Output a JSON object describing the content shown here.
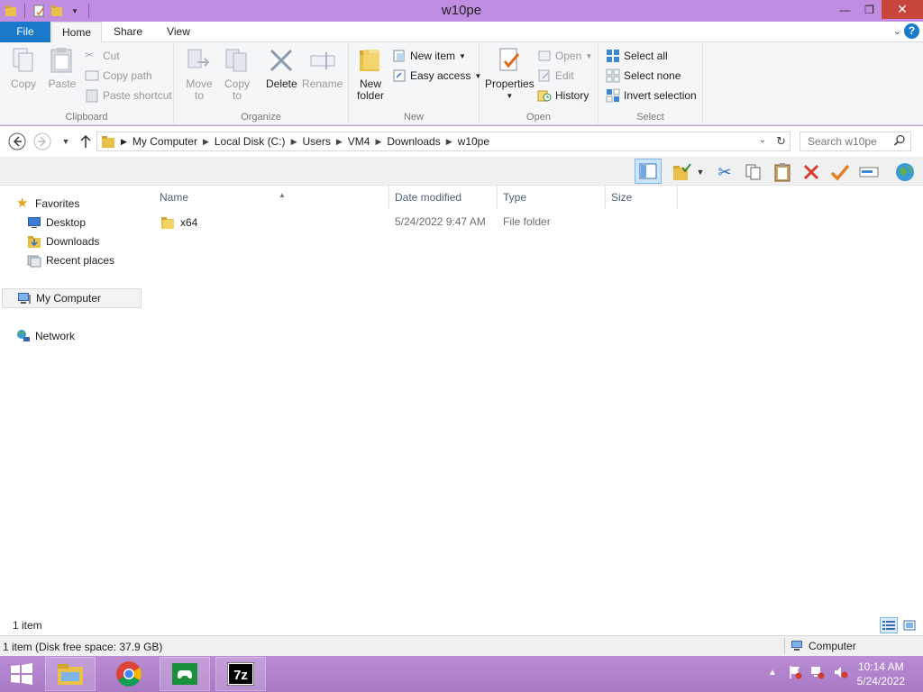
{
  "window": {
    "title": "w10pe"
  },
  "tabs": {
    "file": "File",
    "home": "Home",
    "share": "Share",
    "view": "View"
  },
  "ribbon": {
    "clipboard": {
      "label": "Clipboard",
      "copy": "Copy",
      "paste": "Paste",
      "cut": "Cut",
      "copy_path": "Copy path",
      "paste_shortcut": "Paste shortcut"
    },
    "organize": {
      "label": "Organize",
      "move_to_1": "Move",
      "move_to_2": "to",
      "copy_to_1": "Copy",
      "copy_to_2": "to",
      "delete": "Delete",
      "rename": "Rename"
    },
    "new": {
      "label": "New",
      "new_folder_1": "New",
      "new_folder_2": "folder",
      "new_item": "New item",
      "easy_access": "Easy access"
    },
    "open": {
      "label": "Open",
      "properties": "Properties",
      "open": "Open",
      "edit": "Edit",
      "history": "History"
    },
    "select": {
      "label": "Select",
      "select_all": "Select all",
      "select_none": "Select none",
      "invert_selection": "Invert selection"
    }
  },
  "address": {
    "breadcrumbs": [
      "My Computer",
      "Local Disk (C:)",
      "Users",
      "VM4",
      "Downloads",
      "w10pe"
    ],
    "search_placeholder": "Search w10pe"
  },
  "navpane": {
    "favorites": "Favorites",
    "desktop": "Desktop",
    "downloads": "Downloads",
    "recent_places": "Recent places",
    "my_computer": "My Computer",
    "network": "Network"
  },
  "filelist": {
    "columns": {
      "name": "Name",
      "date_modified": "Date modified",
      "type": "Type",
      "size": "Size"
    },
    "rows": [
      {
        "name": "x64",
        "date_modified": "5/24/2022 9:47 AM",
        "type": "File folder",
        "size": ""
      }
    ]
  },
  "status": {
    "items": "1 item"
  },
  "details": {
    "left": "1 item (Disk free space: 37.9 GB)",
    "right": "Computer"
  },
  "taskbar": {
    "pinned": [
      "file-explorer-icon",
      "chrome-icon",
      "game-icon",
      "7zip-icon"
    ],
    "time": "10:14 AM",
    "date": "5/24/2022"
  },
  "colors": {
    "title_bar": "#c18de0",
    "file_tab": "#1979ca",
    "close_button": "#c7453b",
    "taskbar": "#b98cd4"
  }
}
